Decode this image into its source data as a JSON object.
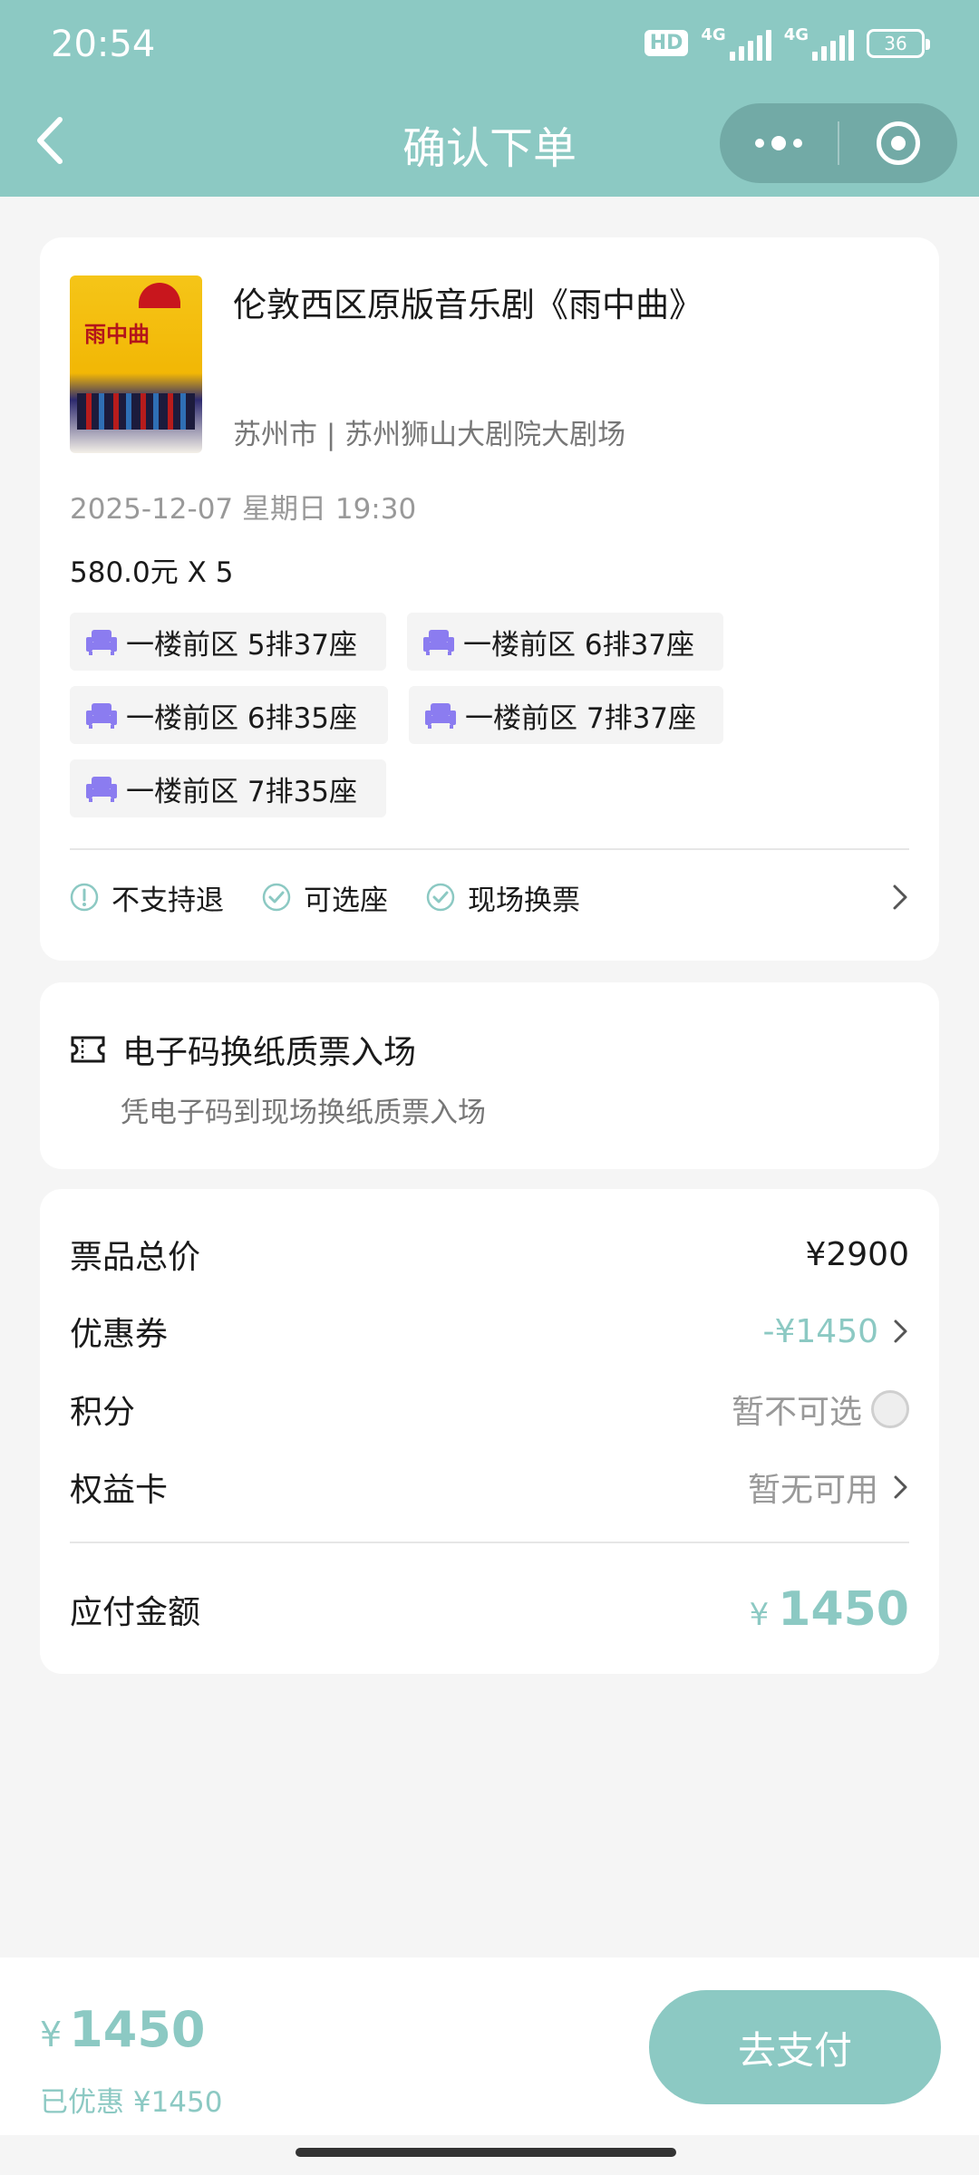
{
  "status_bar": {
    "time": "20:54",
    "hd_badge": "HD",
    "network_1": "4G",
    "network_2": "4G",
    "battery": "36"
  },
  "header": {
    "title": "确认下单",
    "back_icon": "chevron-left-icon",
    "more_icon": "more-dots-icon",
    "close_icon": "target-circle-icon"
  },
  "show": {
    "title": "伦敦西区原版音乐剧《雨中曲》",
    "poster_text": "雨中曲",
    "venue": "苏州市 | 苏州狮山大剧院大剧场",
    "datetime": "2025-12-07 星期日 19:30",
    "price_qty": "580.0元 X 5",
    "seats": [
      {
        "label": "一楼前区 5排37座"
      },
      {
        "label": "一楼前区 6排37座"
      },
      {
        "label": "一楼前区 6排35座"
      },
      {
        "label": "一楼前区 7排37座"
      },
      {
        "label": "一楼前区 7排35座"
      }
    ],
    "policies": [
      {
        "label": "不支持退",
        "icon": "exclamation-circle-icon"
      },
      {
        "label": "可选座",
        "icon": "check-circle-icon"
      },
      {
        "label": "现场换票",
        "icon": "check-circle-icon"
      }
    ]
  },
  "ticket": {
    "title": "电子码换纸质票入场",
    "subtitle": "凭电子码到现场换纸质票入场"
  },
  "pricing": {
    "total_label": "票品总价",
    "total_value": "¥2900",
    "coupon_label": "优惠券",
    "coupon_value": "-¥1450",
    "points_label": "积分",
    "points_value": "暂不可选",
    "card_label": "权益卡",
    "card_value": "暂无可用",
    "payable_label": "应付金额",
    "payable_currency": "¥",
    "payable_amount": "1450"
  },
  "bottom_bar": {
    "currency": "¥",
    "amount": "1450",
    "saved": "已优惠 ¥1450",
    "pay_button": "去支付"
  },
  "colors": {
    "accent": "#8cc9c3",
    "seat_icon": "#8b7cf0",
    "background": "#f5f5f5"
  }
}
